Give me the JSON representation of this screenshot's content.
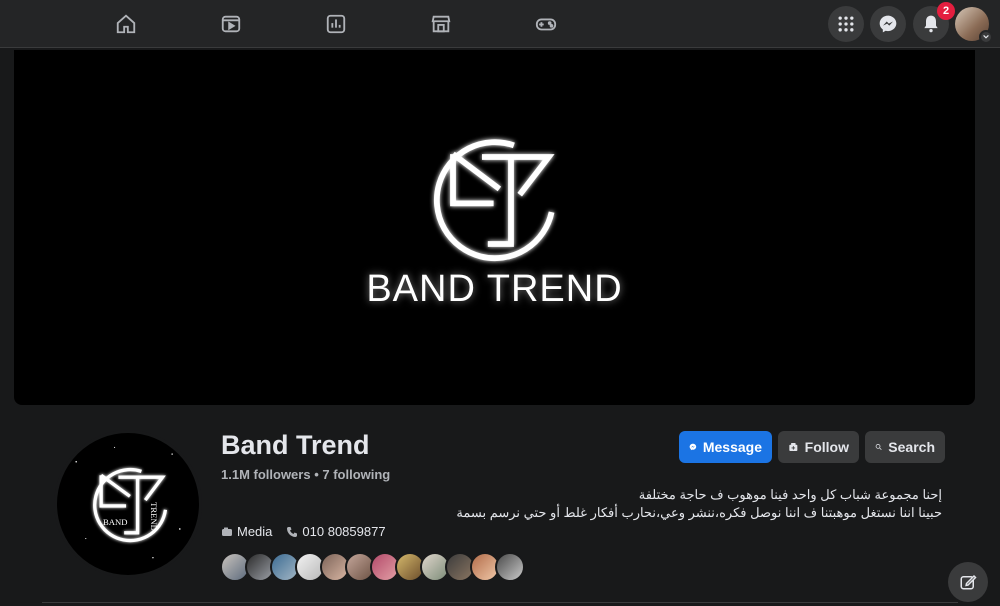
{
  "nav": {
    "icons": [
      "home-icon",
      "watch-icon",
      "stats-icon",
      "marketplace-icon",
      "gaming-icon"
    ],
    "notifications_count": "2"
  },
  "cover": {
    "brand_text": "BAND TREND"
  },
  "page": {
    "name": "Band Trend",
    "followers_text": "1.1M followers • 7 following",
    "bio_line1": "إحنا مجموعة شباب كل واحد فينا موهوب ف حاجة مختلفة",
    "bio_line2": "حبينا اننا نستغل موهبتنا ف اننا نوصل فكره،ننشر وعي،نحارب أفكار غلط أو حتي نرسم بسمة",
    "media_label": "Media",
    "phone": "010 80859877"
  },
  "actions": {
    "message_label": "Message",
    "follow_label": "Follow",
    "search_label": "Search"
  },
  "profile_logo_text": "BAND TREND",
  "colors": {
    "accent": "#1b74e4",
    "badge": "#e41e3f",
    "background": "#18191a",
    "surface": "#242526"
  }
}
